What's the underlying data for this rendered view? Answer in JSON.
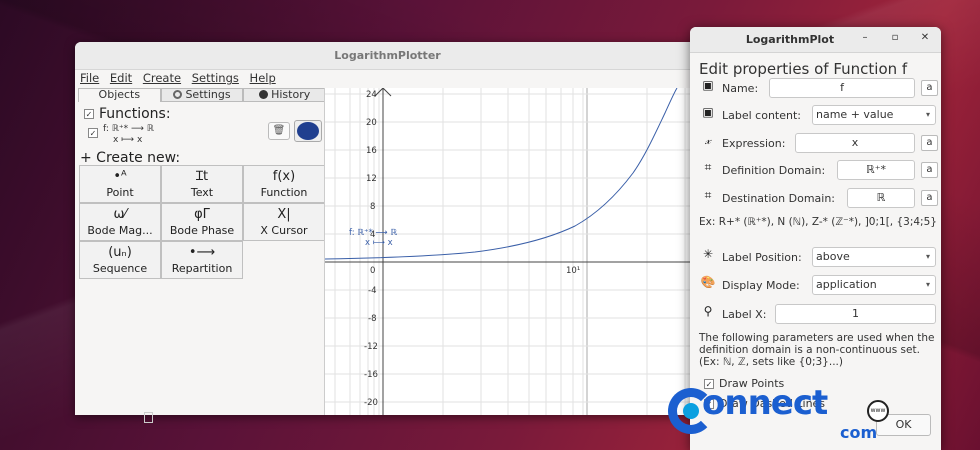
{
  "main_window": {
    "title": "LogarithmPlotter",
    "menu": [
      "File",
      "Edit",
      "Create",
      "Settings",
      "Help"
    ],
    "tabs": [
      "Objects",
      "Settings",
      "History"
    ],
    "functions_header": "Functions:",
    "function_entry": {
      "line1": "f: ℝ⁺* ⟶ ℝ",
      "line2": "x ⟼ x",
      "color": "#203f8f"
    },
    "create_new": "+ Create new:",
    "create_buttons": [
      {
        "icon": "•ᴬ",
        "label": "Point"
      },
      {
        "icon": "Ɪt",
        "label": "Text"
      },
      {
        "icon": "f(x)",
        "label": "Function"
      },
      {
        "icon": "ω⁄",
        "label": "Bode Mag..."
      },
      {
        "icon": "φΓ",
        "label": "Bode Phase"
      },
      {
        "icon": "X|",
        "label": "X Cursor"
      },
      {
        "icon": "(uₙ)",
        "label": "Sequence"
      },
      {
        "icon": "•⟶",
        "label": "Repartition"
      }
    ]
  },
  "plot": {
    "y_ticks": [
      "24",
      "20",
      "16",
      "12",
      "8",
      "4",
      "0",
      "-4",
      "-8",
      "-12",
      "-16",
      "-20"
    ],
    "x_tick": "10¹",
    "func_label_line1": "f: ℝ⁺* ⟶ ℝ",
    "func_label_line2": "x ⟼ x",
    "curve_color": "#3a5fa8"
  },
  "dialog": {
    "title": "LogarithmPlot",
    "heading": "Edit properties of Function f",
    "name_label": "Name:",
    "name_value": "f",
    "label_content_label": "Label content:",
    "label_content_value": "name + value",
    "expression_label": "Expression:",
    "expression_value": "x",
    "definition_domain_label": "Definition Domain:",
    "definition_domain_value": "ℝ⁺*",
    "destination_domain_label": "Destination Domain:",
    "destination_domain_value": "ℝ",
    "domain_examples": "Ex: R+* (ℝ⁺*), N (ℕ), Z-* (ℤ⁻*), ]0;1[, {3;4;5}",
    "label_position_label": "Label Position:",
    "label_position_value": "above",
    "display_mode_label": "Display Mode:",
    "display_mode_value": "application",
    "label_x_label": "Label X:",
    "label_x_value": "1",
    "help_text": "The following parameters are used when the definition domain is a non-continuous set. (Ex: ℕ, ℤ, sets like {0;3}...)",
    "draw_points_label": "Draw Points",
    "draw_dashed_label": "Draw Dashed Lines",
    "ok_label": "OK",
    "a_button": "a"
  },
  "watermark": {
    "word": "onnect",
    "suffix": "com",
    "globe": "www"
  }
}
